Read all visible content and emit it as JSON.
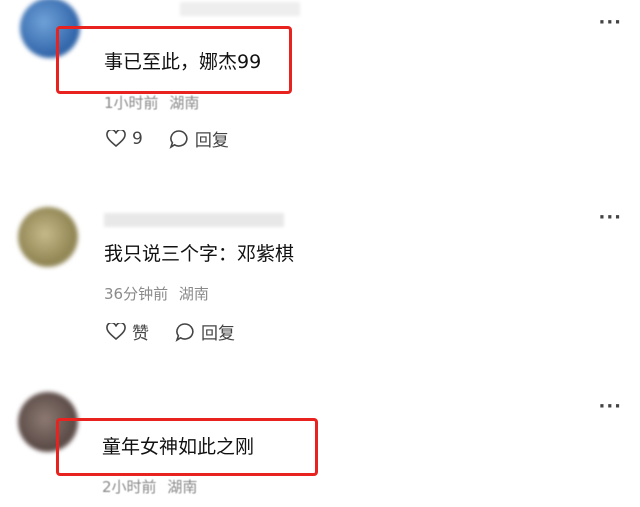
{
  "colors": {
    "highlight": "#e8231f",
    "meta": "#8a8a8a",
    "text": "#111111"
  },
  "comments": [
    {
      "text": "事已至此，娜杰99",
      "time": "1小时前",
      "location": "湖南",
      "like_label": "9",
      "reply_label": "回复"
    },
    {
      "text": "我只说三个字：邓紫棋",
      "time": "36分钟前",
      "location": "湖南",
      "like_label": "赞",
      "reply_label": "回复"
    },
    {
      "text": "童年女神如此之刚",
      "time": "2小时前",
      "location": "湖南"
    }
  ],
  "icons": {
    "more": "more-icon",
    "like": "heart-icon",
    "reply": "comment-bubble-icon"
  }
}
